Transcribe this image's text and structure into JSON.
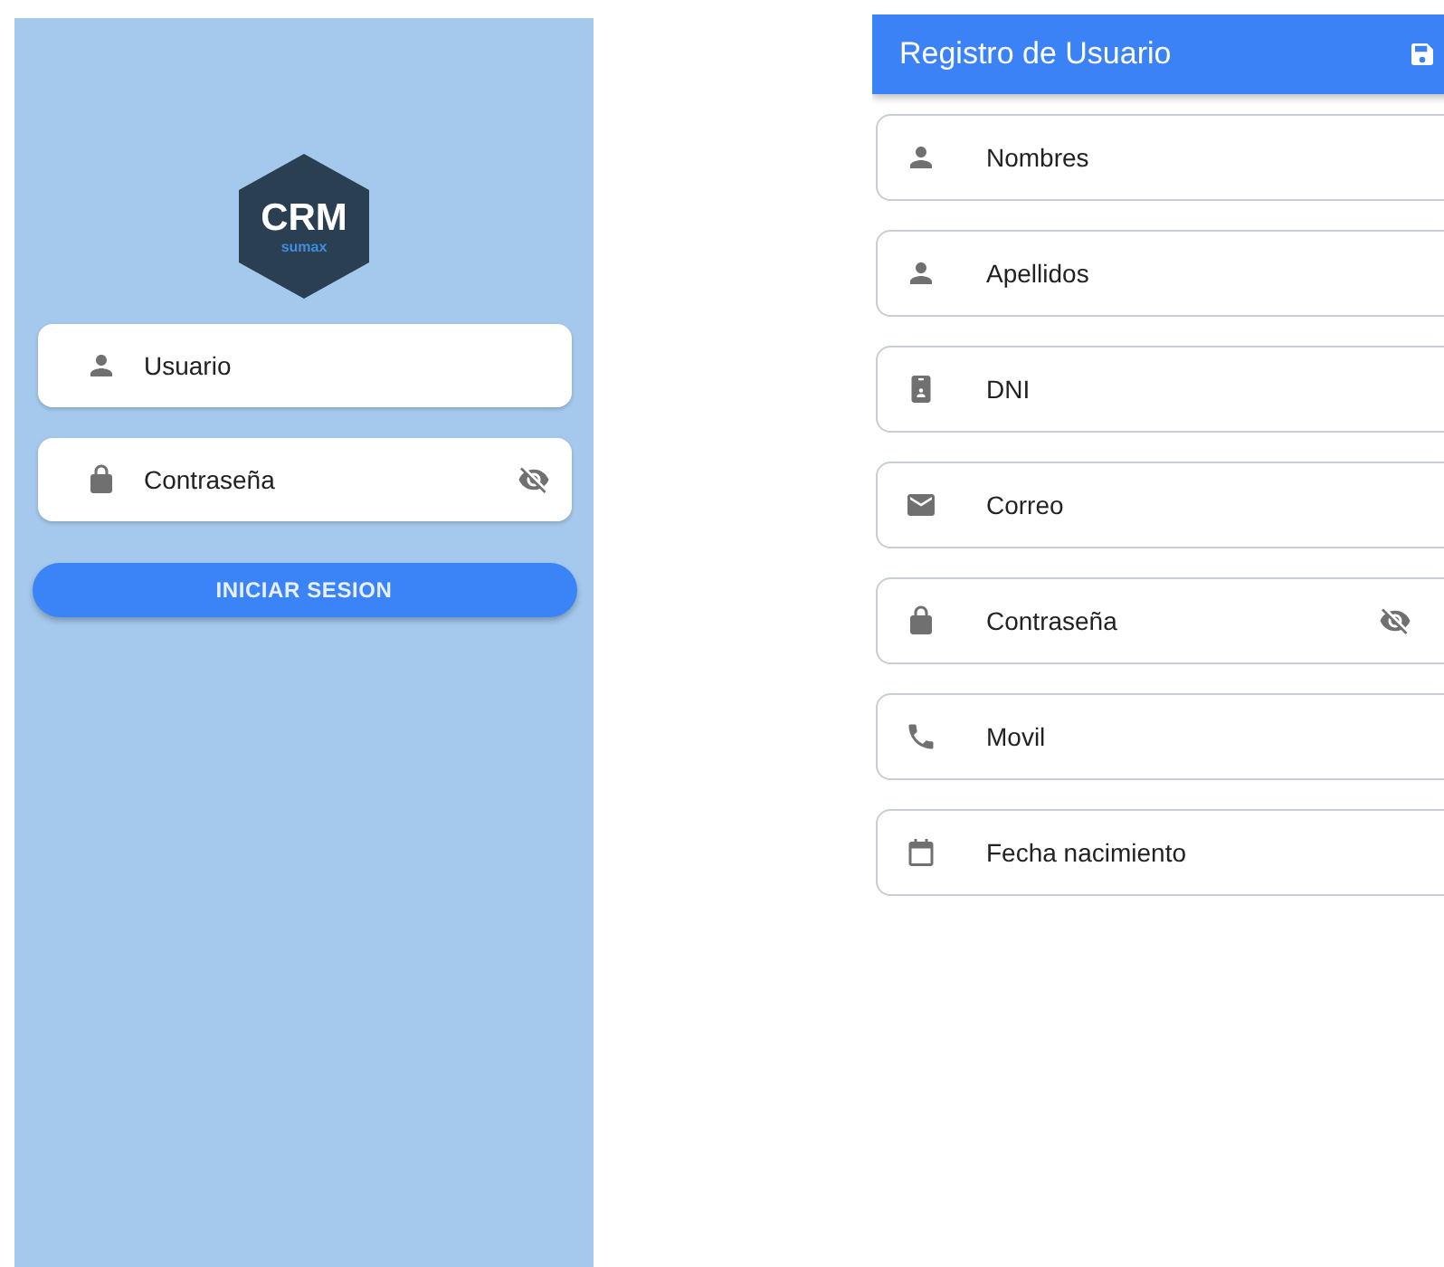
{
  "login": {
    "logo": {
      "title": "CRM",
      "subtitle": "sumax"
    },
    "fields": [
      {
        "kind": "person",
        "placeholder": "Usuario",
        "password": false
      },
      {
        "kind": "lock",
        "placeholder": "Contraseña",
        "password": true
      }
    ],
    "button": "INICIAR SESION"
  },
  "register": {
    "title": "Registro de Usuario",
    "fields": [
      {
        "kind": "person",
        "placeholder": "Nombres",
        "password": false
      },
      {
        "kind": "person",
        "placeholder": "Apellidos",
        "password": false
      },
      {
        "kind": "id-card",
        "placeholder": "DNI",
        "password": false
      },
      {
        "kind": "mail",
        "placeholder": "Correo",
        "password": false
      },
      {
        "kind": "lock",
        "placeholder": "Contraseña",
        "password": true
      },
      {
        "kind": "phone",
        "placeholder": "Movil",
        "password": false
      },
      {
        "kind": "calendar",
        "placeholder": "Fecha nacimiento",
        "password": false
      }
    ]
  }
}
